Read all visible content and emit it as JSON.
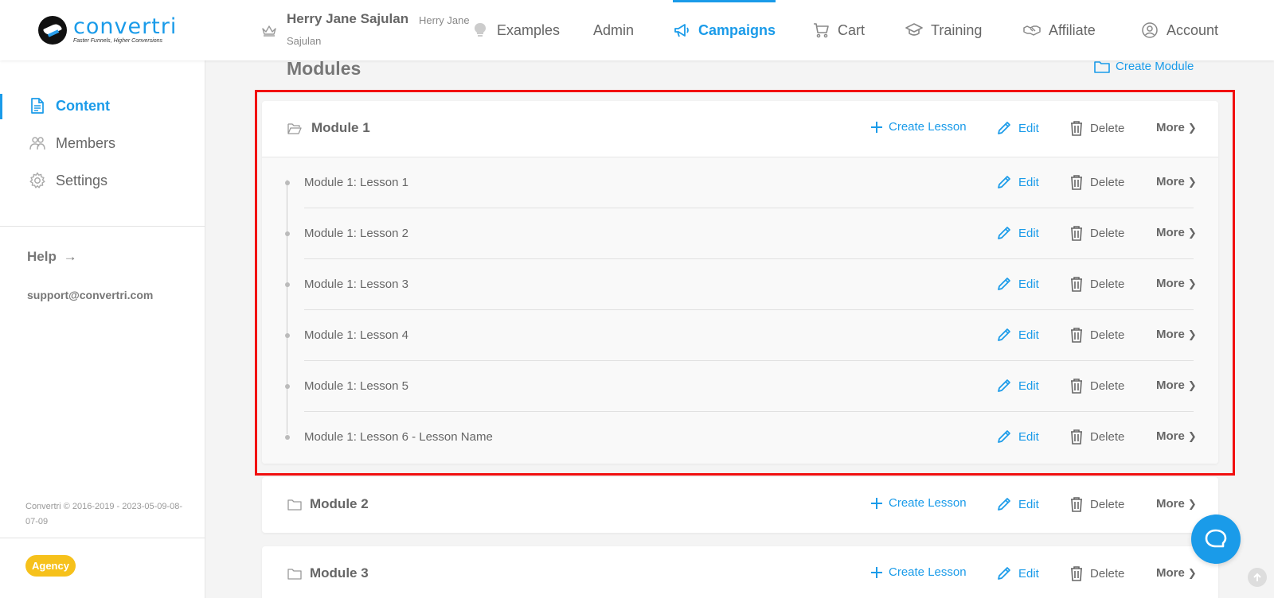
{
  "brand": {
    "name": "convertri",
    "tagline": "Faster Funnels, Higher Conversions"
  },
  "user": {
    "name": "Herry Jane Sajulan",
    "sub_line1": "Herry Jane",
    "sub_line2": "Sajulan"
  },
  "nav": {
    "examples": "Examples",
    "admin": "Admin",
    "campaigns": "Campaigns",
    "cart": "Cart",
    "training": "Training",
    "affiliate": "Affiliate",
    "account": "Account"
  },
  "sidebar": {
    "content": "Content",
    "members": "Members",
    "settings": "Settings",
    "help": "Help",
    "support_email": "support@convertri.com",
    "copyright": "Convertri © 2016-2019 - 2023-05-09-08-07-09",
    "badge": "Agency"
  },
  "main": {
    "title": "Modules",
    "create_module": "Create Module",
    "actions": {
      "create_lesson": "Create Lesson",
      "edit": "Edit",
      "delete": "Delete",
      "more": "More"
    },
    "modules": [
      {
        "title": "Module 1",
        "lessons": [
          "Module 1: Lesson 1",
          "Module 1: Lesson 2",
          "Module 1: Lesson 3",
          "Module 1: Lesson 4",
          "Module 1: Lesson 5",
          "Module 1: Lesson 6 - Lesson Name"
        ]
      },
      {
        "title": "Module 2",
        "lessons": []
      },
      {
        "title": "Module 3",
        "lessons": []
      }
    ]
  },
  "colors": {
    "accent": "#1a9be9",
    "highlight": "#f10f0f",
    "badge": "#f6c11b"
  }
}
